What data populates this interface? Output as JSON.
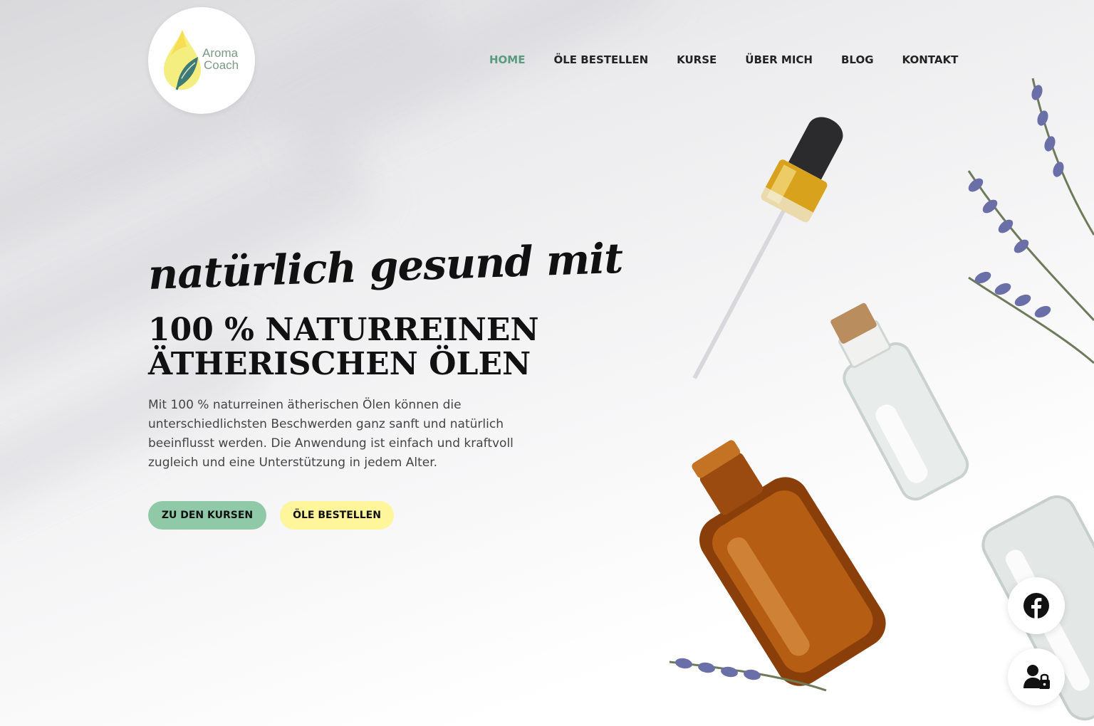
{
  "logo": {
    "line1": "Aroma",
    "line2": "Coach"
  },
  "nav": {
    "items": [
      {
        "label": "HOME",
        "active": true
      },
      {
        "label": "ÖLE BESTELLEN",
        "active": false
      },
      {
        "label": "KURSE",
        "active": false
      },
      {
        "label": "ÜBER MICH",
        "active": false
      },
      {
        "label": "BLOG",
        "active": false
      },
      {
        "label": "KONTAKT",
        "active": false
      }
    ]
  },
  "hero": {
    "tagline": "natürlich gesund mit",
    "headline_line1": "100 % NATURREINEN",
    "headline_line2": "ÄTHERISCHEN ÖLEN",
    "intro": "Mit  100 % naturreinen ätherischen Ölen können die unterschiedlichsten Beschwerden ganz sanft und natürlich beeinflusst werden. Die Anwendung ist einfach und kraftvoll zugleich und eine Unterstützung in jedem Alter.",
    "button_courses": "ZU DEN KURSEN",
    "button_order": "ÖLE BESTELLEN"
  },
  "social": {
    "facebook_icon": "facebook-icon",
    "login_icon": "user-lock-icon"
  },
  "colors": {
    "accent_green": "#5a9a7e",
    "button_green": "#8fc9a8",
    "button_yellow": "#fff59a",
    "text_dark": "#111111"
  }
}
